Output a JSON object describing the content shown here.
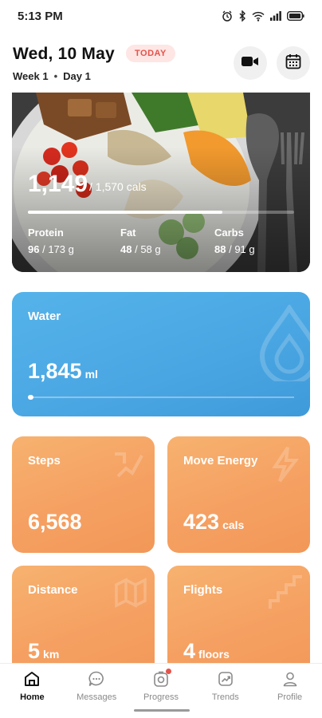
{
  "status_bar": {
    "time": "5:13 PM",
    "battery": ""
  },
  "header": {
    "date": "Wed, 10 May",
    "today_badge": "TODAY",
    "week": "Week 1",
    "separator": "•",
    "day": "Day 1",
    "video_icon": "video-camera-icon",
    "calendar_icon": "calendar-icon"
  },
  "meal": {
    "calories_consumed": "1,149",
    "calories_goal": "/ 1,570 cals",
    "progress": 0.73,
    "macros": [
      {
        "label": "Protein",
        "value": "96",
        "goal": "/ 173 g"
      },
      {
        "label": "Fat",
        "value": "48",
        "goal": "/ 58 g"
      },
      {
        "label": "Carbs",
        "value": "88",
        "goal": "/ 91 g"
      }
    ]
  },
  "water": {
    "title": "Water",
    "value": "1,845",
    "unit": "ml",
    "progress": 0.02,
    "icon": "water-drop-icon"
  },
  "stats": [
    {
      "title": "Steps",
      "value": "6,568",
      "unit": "",
      "icon": "steps-icon"
    },
    {
      "title": "Move Energy",
      "value": "423",
      "unit": "cals",
      "icon": "energy-icon"
    },
    {
      "title": "Distance",
      "value": "5",
      "unit": "km",
      "icon": "distance-icon"
    },
    {
      "title": "Flights",
      "value": "4",
      "unit": "floors",
      "icon": "flights-icon"
    }
  ],
  "nav": [
    {
      "label": "Home",
      "icon": "home-icon",
      "active": true
    },
    {
      "label": "Messages",
      "icon": "messages-icon",
      "active": false
    },
    {
      "label": "Progress",
      "icon": "progress-icon",
      "active": false,
      "badge": true
    },
    {
      "label": "Trends",
      "icon": "trends-icon",
      "active": false
    },
    {
      "label": "Profile",
      "icon": "profile-icon",
      "active": false
    }
  ],
  "colors": {
    "water": "#4aa6e2",
    "stat_orange": "#f5a062",
    "today_badge_text": "#e5534b",
    "today_badge_bg": "#fde6e4"
  }
}
